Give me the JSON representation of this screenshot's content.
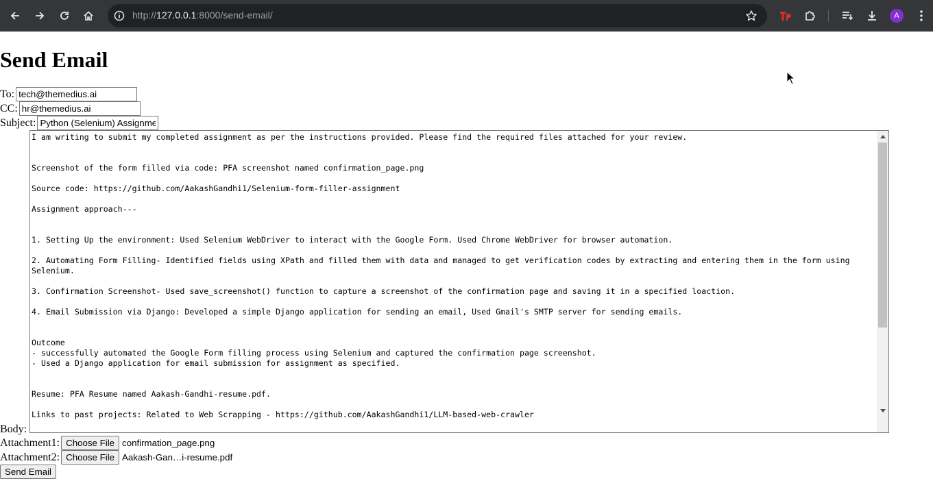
{
  "browser": {
    "url_prefix": "http://",
    "url_host": "127.0.0.1",
    "url_rest": ":8000/send-email/",
    "avatar_letter": "A",
    "icons": [
      "back-icon",
      "forward-icon",
      "reload-icon",
      "home-icon",
      "site-info-icon",
      "bookmark-star-icon",
      "extension-tp-icon",
      "extensions-puzzle-icon",
      "reading-list-icon",
      "download-icon",
      "menu-kebab-icon"
    ]
  },
  "page": {
    "title": "Send Email",
    "to_label": "To:",
    "to_value": "tech@themedius.ai",
    "cc_label": "CC:",
    "cc_value": "hr@themedius.ai",
    "subject_label": "Subject:",
    "subject_value": "Python (Selenium) Assignment",
    "body_label": "Body:",
    "body_value": "I am writing to submit my completed assignment as per the instructions provided. Please find the required files attached for your review.\n\n\nScreenshot of the form filled via code: PFA screenshot named confirmation_page.png\n\nSource code: https://github.com/AakashGandhi1/Selenium-form-filler-assignment\n\nAssignment approach---\n\n\n1. Setting Up the environment: Used Selenium WebDriver to interact with the Google Form. Used Chrome WebDriver for browser automation.\n\n2. Automating Form Filling- Identified fields using XPath and filled them with data and managed to get verification codes by extracting and entering them in the form using Selenium.\n\n3. Confirmation Screenshot- Used save_screenshot() function to capture a screenshot of the confirmation page and saving it in a specified loaction.\n\n4. Email Submission via Django: Developed a simple Django application for sending an email, Used Gmail's SMTP server for sending emails.\n\n\nOutcome\n- successfully automated the Google Form filling process using Selenium and captured the confirmation page screenshot.\n- Used a Django application for email submission for assignment as specified.\n\n\nResume: PFA Resume named Aakash-Gandhi-resume.pdf.\n\nLinks to past projects: Related to Web Scrapping - https://github.com/AakashGandhi1/LLM-based-web-crawler",
    "attachment1_label": "Attachment1:",
    "attachment1_button": "Choose File",
    "attachment1_file": "confirmation_page.png",
    "attachment2_label": "Attachment2:",
    "attachment2_button": "Choose File",
    "attachment2_file": "Aakash-Gan…i-resume.pdf",
    "send_button": "Send Email"
  }
}
